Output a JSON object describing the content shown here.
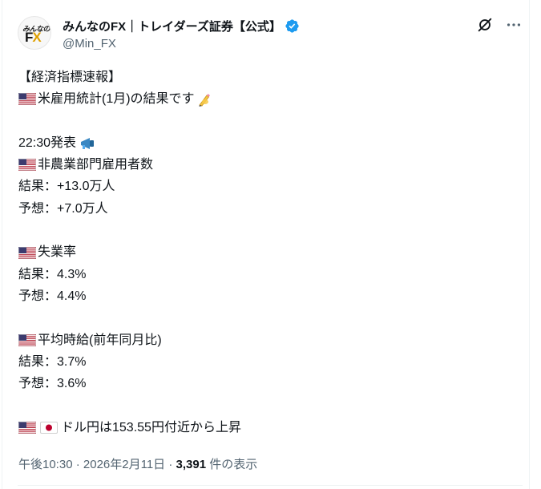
{
  "account": {
    "display_name": "みんなのFX｜トレイダーズ証券【公式】",
    "handle": "@Min_FX",
    "avatar_line1": "みんなの",
    "avatar_fx_f": "F",
    "avatar_fx_x": "X",
    "verified_color": "#1d9bf0"
  },
  "icons": {
    "verified": "verified-badge-icon",
    "grok": "grok-icon",
    "more": "more-options-icon",
    "us_flag": "us-flag-icon",
    "jp_flag": "japan-flag-icon",
    "writing_hand": "writing-hand-icon",
    "megaphone": "megaphone-icon"
  },
  "post": {
    "heading": "【経済指標速報】",
    "subject": "米雇用統計(1月)の結果です",
    "release_time": "22:30発表",
    "nfp": {
      "title": "非農業部門雇用者数",
      "result": "結果：+13.0万人",
      "forecast": "予想：+7.0万人"
    },
    "unemployment": {
      "title": "失業率",
      "result": "結果：4.3%",
      "forecast": "予想：4.4%"
    },
    "earnings": {
      "title": "平均時給(前年同月比)",
      "result": "結果：3.7%",
      "forecast": "予想：3.6%"
    },
    "usdjpy": "ドル円は153.55円付近から上昇"
  },
  "meta": {
    "time": "午後10:30",
    "separator1": " · ",
    "date": "2026年2月11日",
    "separator2": " · ",
    "views_count": "3,391",
    "views_label": " 件の表示"
  }
}
